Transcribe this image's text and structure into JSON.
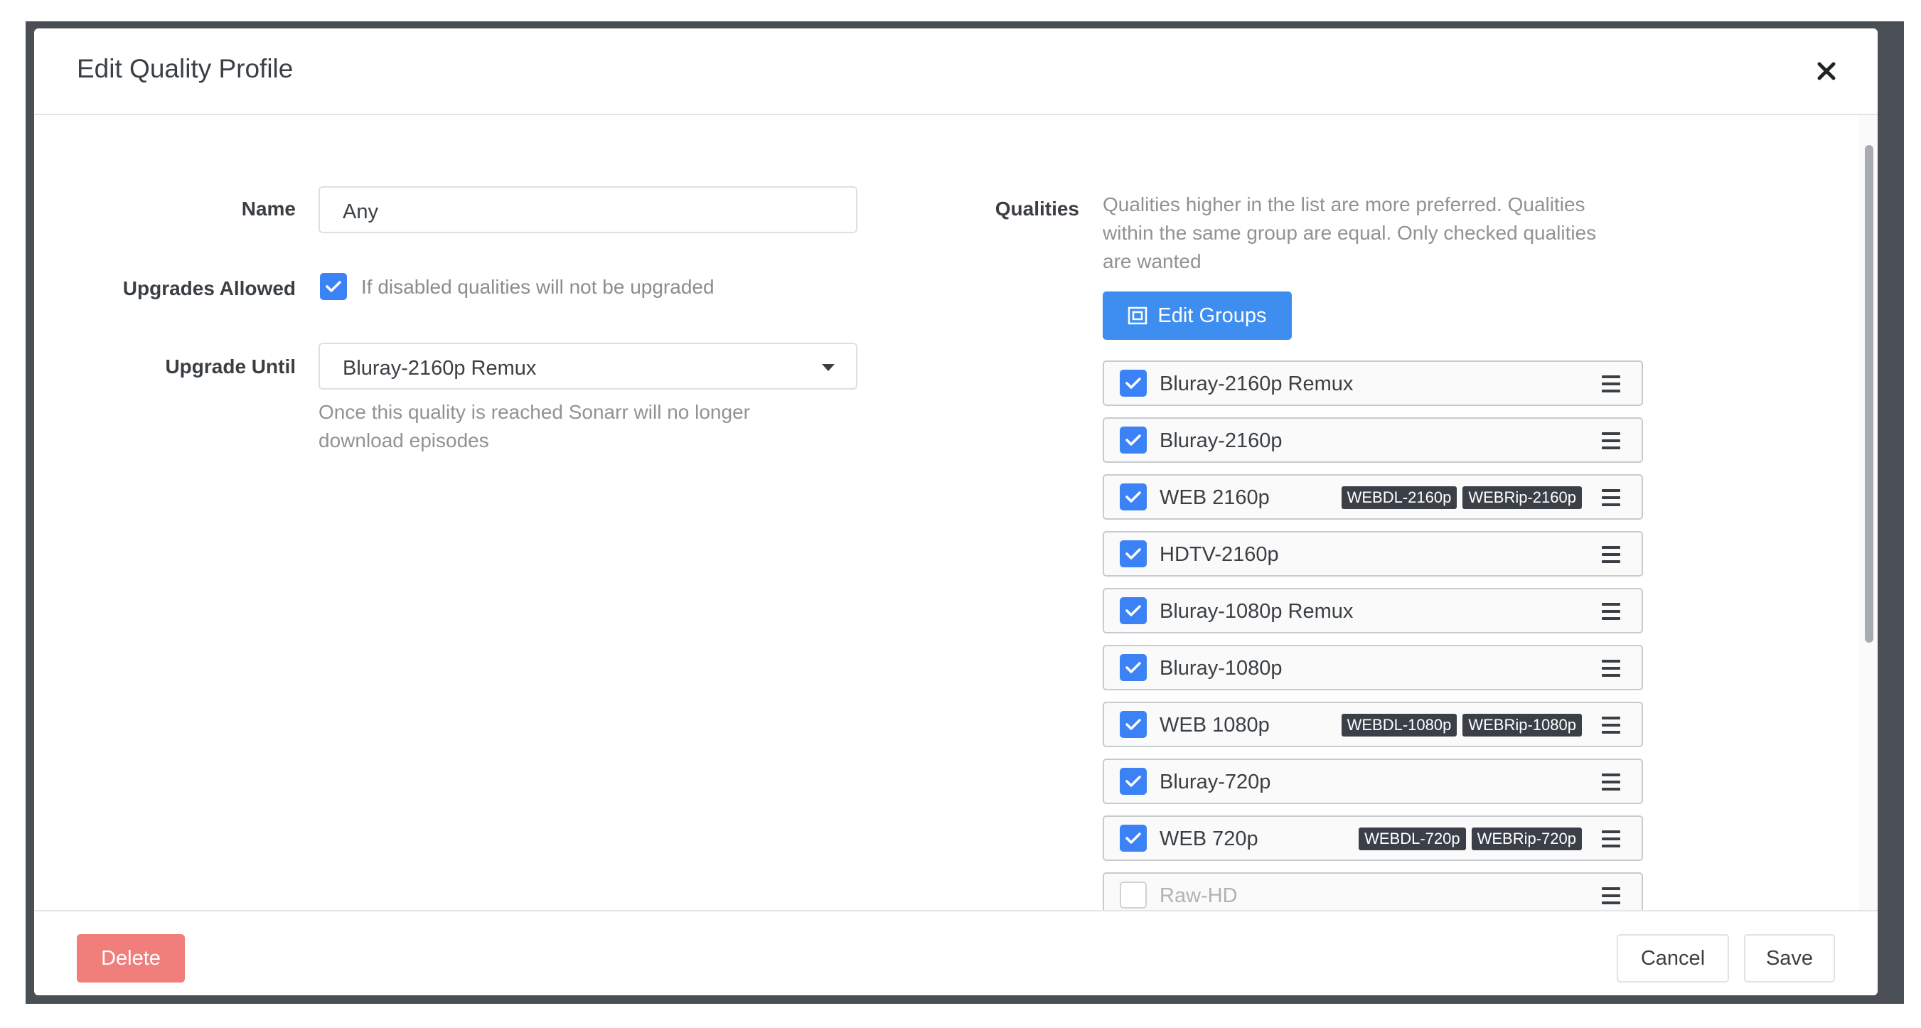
{
  "dialog": {
    "title": "Edit Quality Profile"
  },
  "form": {
    "name": {
      "label": "Name",
      "value": "Any"
    },
    "upgrades_allowed": {
      "label": "Upgrades Allowed",
      "checked": true,
      "help": "If disabled qualities will not be upgraded"
    },
    "upgrade_until": {
      "label": "Upgrade Until",
      "value": "Bluray-2160p Remux",
      "help_line1": "Once this quality is reached Sonarr will no longer",
      "help_line2": "download episodes"
    }
  },
  "qualities": {
    "label": "Qualities",
    "help_line1": "Qualities higher in the list are more preferred. Qualities",
    "help_line2": "within the same group are equal. Only checked qualities",
    "help_line3": "are wanted",
    "edit_groups_label": "Edit Groups",
    "items": [
      {
        "name": "Bluray-2160p Remux",
        "checked": true,
        "tags": []
      },
      {
        "name": "Bluray-2160p",
        "checked": true,
        "tags": []
      },
      {
        "name": "WEB 2160p",
        "checked": true,
        "tags": [
          "WEBDL-2160p",
          "WEBRip-2160p"
        ]
      },
      {
        "name": "HDTV-2160p",
        "checked": true,
        "tags": []
      },
      {
        "name": "Bluray-1080p Remux",
        "checked": true,
        "tags": []
      },
      {
        "name": "Bluray-1080p",
        "checked": true,
        "tags": []
      },
      {
        "name": "WEB 1080p",
        "checked": true,
        "tags": [
          "WEBDL-1080p",
          "WEBRip-1080p"
        ]
      },
      {
        "name": "Bluray-720p",
        "checked": true,
        "tags": []
      },
      {
        "name": "WEB 720p",
        "checked": true,
        "tags": [
          "WEBDL-720p",
          "WEBRip-720p"
        ]
      },
      {
        "name": "Raw-HD",
        "checked": false,
        "tags": []
      }
    ]
  },
  "footer": {
    "delete_label": "Delete",
    "cancel_label": "Cancel",
    "save_label": "Save"
  },
  "colors": {
    "primary": "#3d8ef0",
    "danger": "#f07e7a",
    "tag_bg": "#3b4048"
  }
}
